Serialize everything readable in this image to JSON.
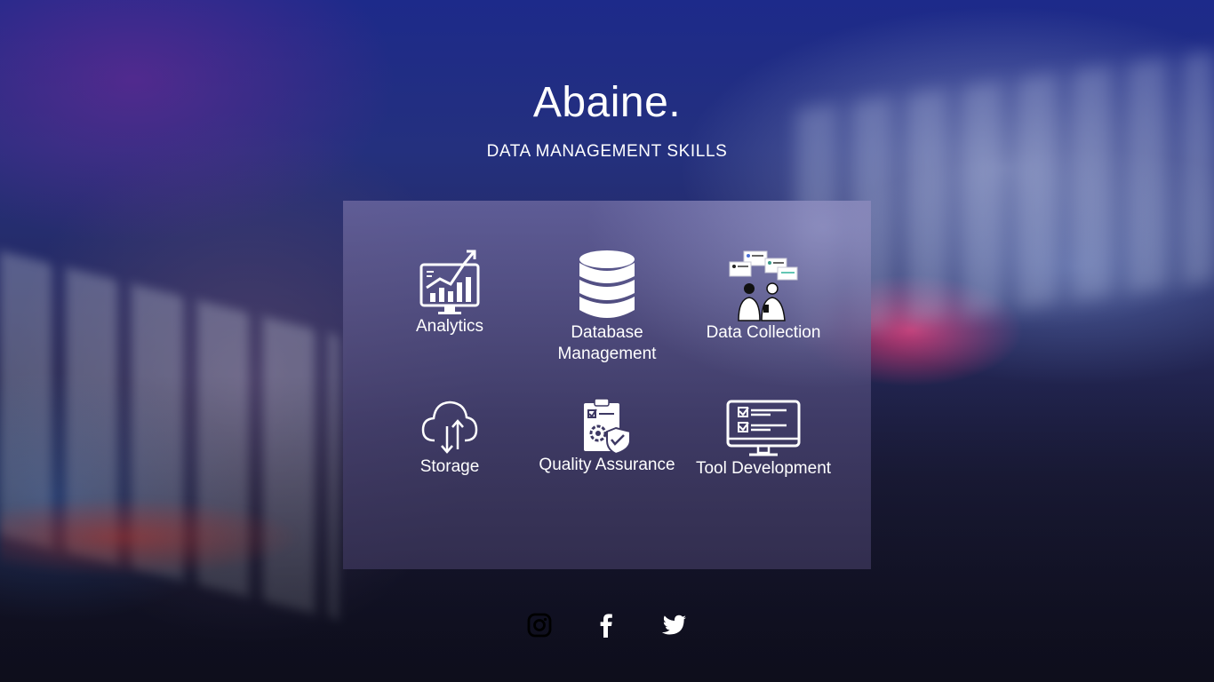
{
  "brand": {
    "name": "Abaine."
  },
  "header": {
    "subtitle": "DATA MANAGEMENT SKILLS"
  },
  "skills": [
    {
      "label": "Analytics",
      "icon": "analytics-monitor-icon"
    },
    {
      "label": "Database Management",
      "icon": "database-icon"
    },
    {
      "label": "Data Collection",
      "icon": "data-collection-illustration"
    },
    {
      "label": "Storage",
      "icon": "cloud-storage-icon"
    },
    {
      "label": "Quality Assurance",
      "icon": "quality-checklist-icon"
    },
    {
      "label": "Tool Development",
      "icon": "monitor-checklist-icon"
    }
  ],
  "social": [
    {
      "name": "instagram",
      "icon": "instagram-icon"
    },
    {
      "name": "facebook",
      "icon": "facebook-icon"
    },
    {
      "name": "twitter",
      "icon": "twitter-icon"
    }
  ],
  "colors": {
    "text": "#ffffff",
    "card_top": "#6e69a0",
    "card_bottom": "#373255",
    "background_dark": "#12132a",
    "accent_glow": "#ff3c78"
  }
}
